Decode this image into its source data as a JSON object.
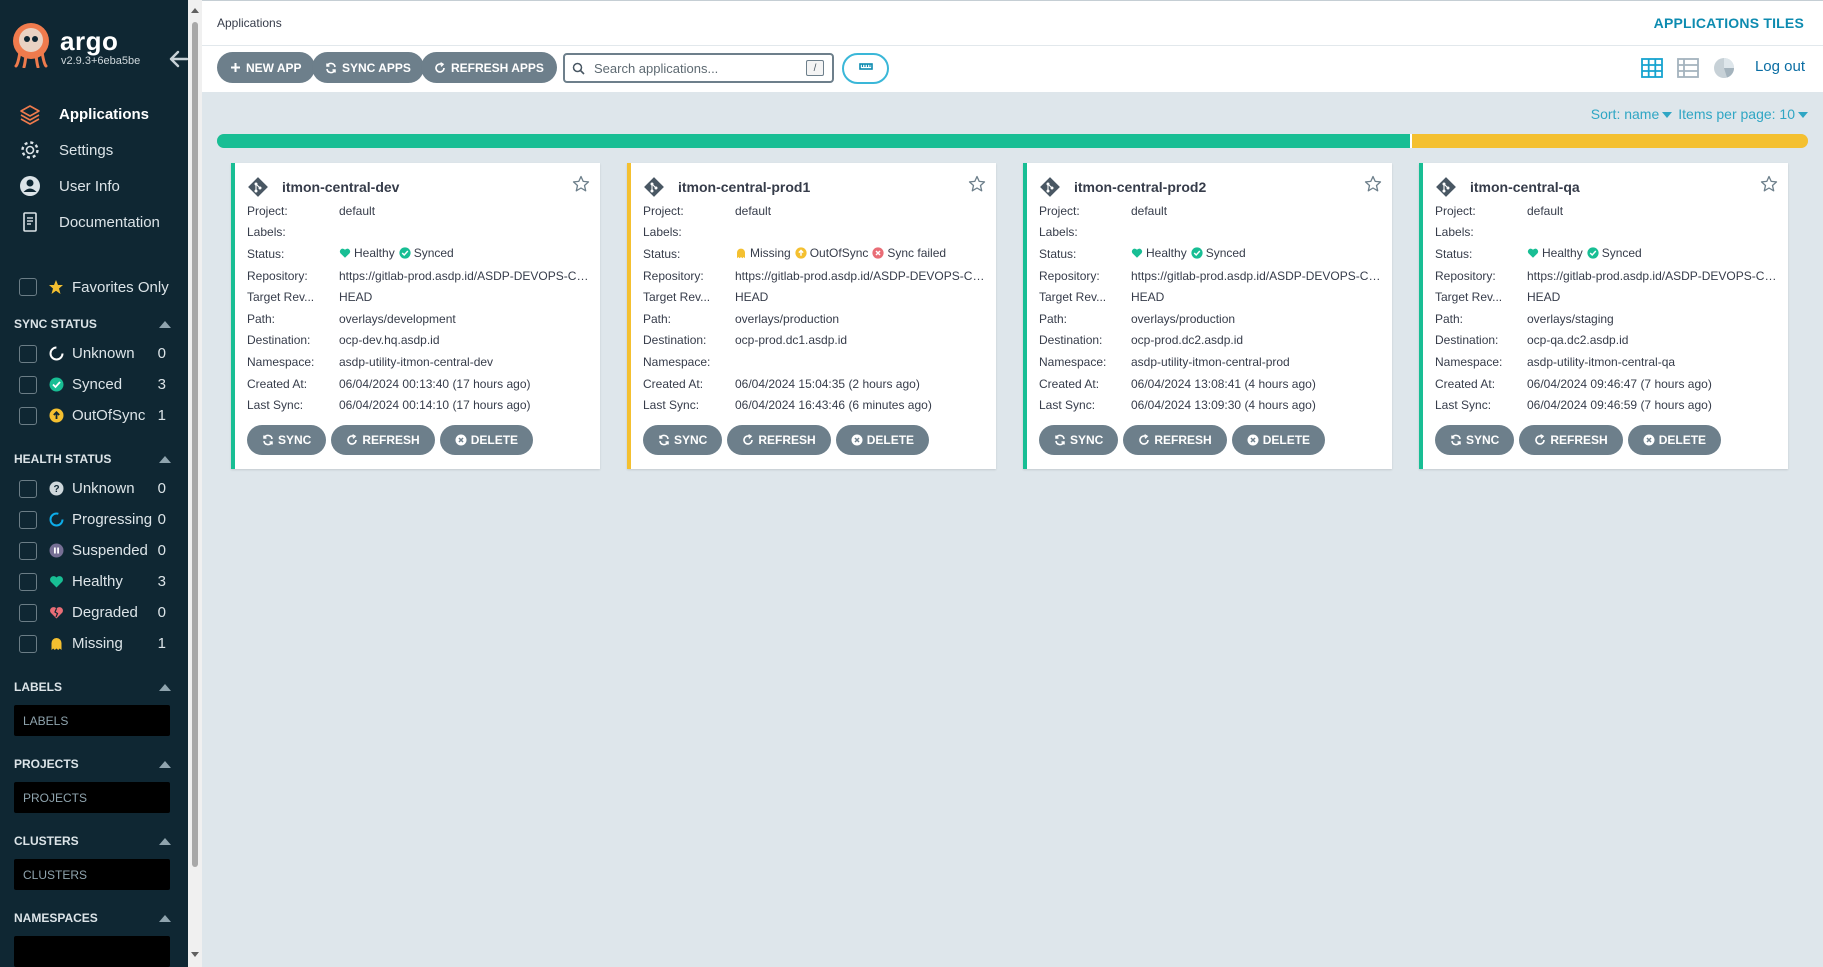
{
  "brand": {
    "name": "argo",
    "version": "v2.9.3+6eba5be"
  },
  "nav": [
    {
      "label": "Applications",
      "icon": "layers-icon",
      "active": true
    },
    {
      "label": "Settings",
      "icon": "gear-icon",
      "active": false
    },
    {
      "label": "User Info",
      "icon": "user-icon",
      "active": false
    },
    {
      "label": "Documentation",
      "icon": "book-icon",
      "active": false
    }
  ],
  "filters": {
    "favorites_label": "Favorites Only",
    "sync_status": {
      "title": "SYNC STATUS",
      "items": [
        {
          "label": "Unknown",
          "count": "0",
          "icon": "unknown-circle-icon"
        },
        {
          "label": "Synced",
          "count": "3",
          "icon": "synced-check-icon"
        },
        {
          "label": "OutOfSync",
          "count": "1",
          "icon": "out-of-sync-icon"
        }
      ]
    },
    "health_status": {
      "title": "HEALTH STATUS",
      "items": [
        {
          "label": "Unknown",
          "count": "0",
          "icon": "question-icon"
        },
        {
          "label": "Progressing",
          "count": "0",
          "icon": "progressing-icon"
        },
        {
          "label": "Suspended",
          "count": "0",
          "icon": "pause-icon"
        },
        {
          "label": "Healthy",
          "count": "3",
          "icon": "heart-icon"
        },
        {
          "label": "Degraded",
          "count": "0",
          "icon": "broken-heart-icon"
        },
        {
          "label": "Missing",
          "count": "1",
          "icon": "ghost-icon"
        }
      ]
    },
    "labels": {
      "title": "LABELS",
      "placeholder": "LABELS"
    },
    "projects": {
      "title": "PROJECTS",
      "placeholder": "PROJECTS"
    },
    "clusters": {
      "title": "CLUSTERS",
      "placeholder": "CLUSTERS"
    },
    "namespaces": {
      "title": "NAMESPACES"
    }
  },
  "topbar": {
    "breadcrumb": "Applications",
    "view_title": "APPLICATIONS TILES",
    "logout": "Log out"
  },
  "toolbar": {
    "new_app": "NEW APP",
    "sync_apps": "SYNC APPS",
    "refresh_apps": "REFRESH APPS",
    "search_placeholder": "Search applications...",
    "search_shortcut": "/"
  },
  "sort": {
    "sort_label": "Sort: name",
    "items_per_page": "Items per page: 10"
  },
  "status_bar": {
    "healthy_fraction": 0.75,
    "missing_fraction": 0.25,
    "colors": {
      "healthy": "#18be94",
      "missing": "#f4c030"
    }
  },
  "labels": {
    "project": "Project:",
    "labels": "Labels:",
    "status": "Status:",
    "repository": "Repository:",
    "target_rev": "Target Rev...",
    "path": "Path:",
    "destination": "Destination:",
    "namespace": "Namespace:",
    "created_at": "Created At:",
    "last_sync": "Last Sync:"
  },
  "actions": {
    "sync": "SYNC",
    "refresh": "REFRESH",
    "delete": "DELETE"
  },
  "apps": [
    {
      "name": "itmon-central-dev",
      "project": "default",
      "labels": "",
      "health": "Healthy",
      "sync": "Synced",
      "op": "",
      "repository": "https://gitlab-prod.asdp.id/ASDP-DEVOPS-CENTRAL",
      "target_rev": "HEAD",
      "path": "overlays/development",
      "destination": "ocp-dev.hq.asdp.id",
      "namespace": "asdp-utility-itmon-central-dev",
      "created_at": "06/04/2024 00:13:40  (17 hours ago)",
      "last_sync": "06/04/2024 00:14:10  (17 hours ago)"
    },
    {
      "name": "itmon-central-prod1",
      "project": "default",
      "labels": "",
      "health": "Missing",
      "sync": "OutOfSync",
      "op": "Sync failed",
      "repository": "https://gitlab-prod.asdp.id/ASDP-DEVOPS-CENTRAL",
      "target_rev": "HEAD",
      "path": "overlays/production",
      "destination": "ocp-prod.dc1.asdp.id",
      "namespace": "",
      "created_at": "06/04/2024 15:04:35  (2 hours ago)",
      "last_sync": "06/04/2024 16:43:46  (6 minutes ago)"
    },
    {
      "name": "itmon-central-prod2",
      "project": "default",
      "labels": "",
      "health": "Healthy",
      "sync": "Synced",
      "op": "",
      "repository": "https://gitlab-prod.asdp.id/ASDP-DEVOPS-CENTRAL",
      "target_rev": "HEAD",
      "path": "overlays/production",
      "destination": "ocp-prod.dc2.asdp.id",
      "namespace": "asdp-utility-itmon-central-prod",
      "created_at": "06/04/2024 13:08:41  (4 hours ago)",
      "last_sync": "06/04/2024 13:09:30  (4 hours ago)"
    },
    {
      "name": "itmon-central-qa",
      "project": "default",
      "labels": "",
      "health": "Healthy",
      "sync": "Synced",
      "op": "",
      "repository": "https://gitlab-prod.asdp.id/ASDP-DEVOPS-CENTRAL",
      "target_rev": "HEAD",
      "path": "overlays/staging",
      "destination": "ocp-qa.dc2.asdp.id",
      "namespace": "asdp-utility-itmon-central-qa",
      "created_at": "06/04/2024 09:46:47  (7 hours ago)",
      "last_sync": "06/04/2024 09:46:59  (7 hours ago)"
    }
  ]
}
